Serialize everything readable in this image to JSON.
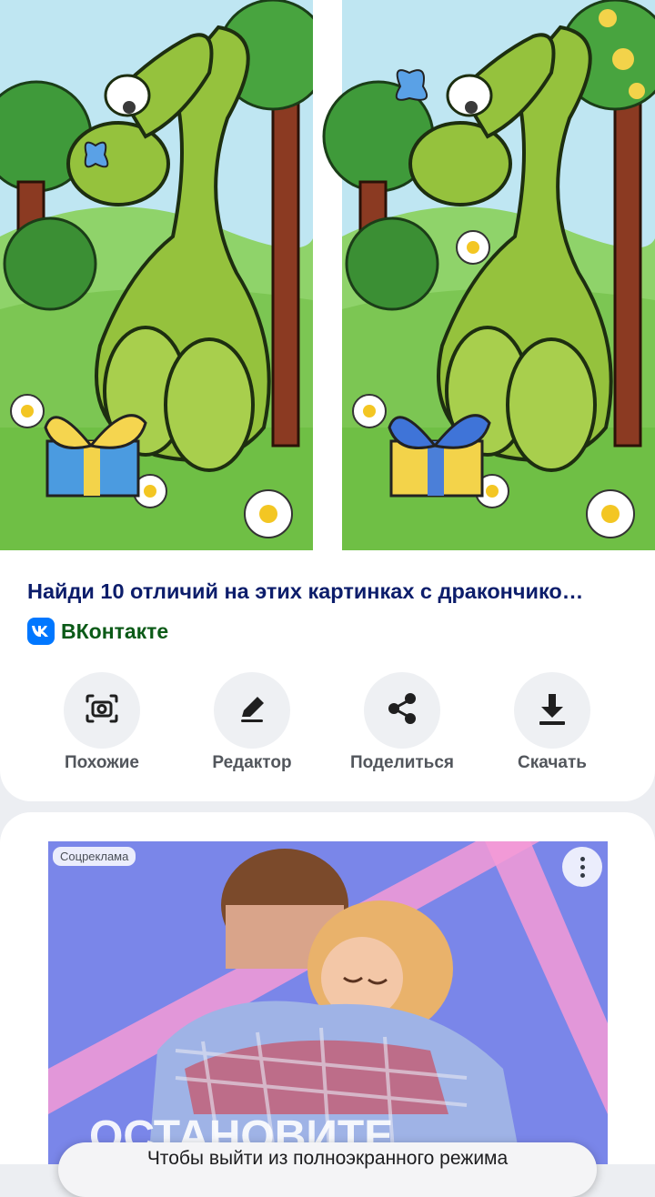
{
  "result": {
    "title": "Найди 10 отличий на этих картинках с дракончико…",
    "source_name": "ВКонтакте",
    "source_icon": "vk-logo-icon",
    "source_icon_color": "#0077ff"
  },
  "actions": [
    {
      "label": "Похожие",
      "icon": "camera-search-icon"
    },
    {
      "label": "Редактор",
      "icon": "pencil-icon"
    },
    {
      "label": "Поделиться",
      "icon": "share-icon"
    },
    {
      "label": "Скачать",
      "icon": "download-icon"
    }
  ],
  "ad": {
    "badge": "Соцреклама",
    "headline_partial": "ОСТАНОВИТЕ"
  },
  "toast": {
    "text": "Чтобы выйти из полноэкранного режима"
  },
  "colors": {
    "title": "#0c1d6b",
    "source": "#0b5a17",
    "action_label": "#52565c",
    "ad_background": "#7a86e9"
  }
}
